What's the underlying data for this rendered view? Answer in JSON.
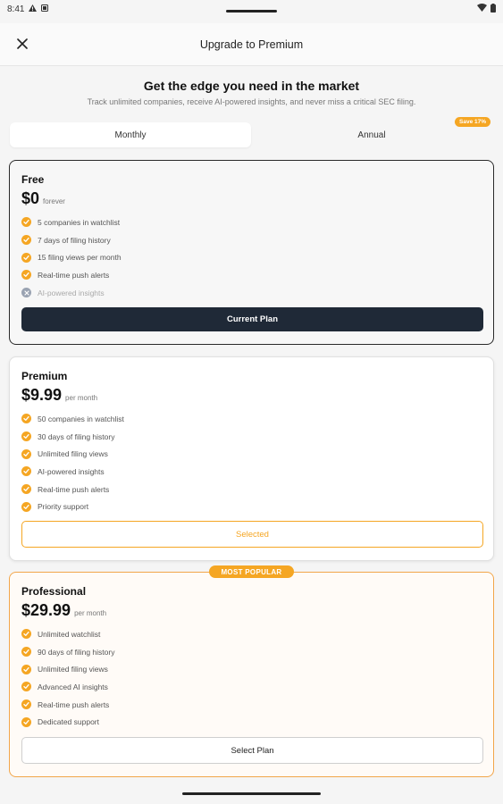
{
  "status": {
    "time": "8:41"
  },
  "appbar": {
    "title": "Upgrade to Premium"
  },
  "header": {
    "headline": "Get the edge you need in the market",
    "subline": "Track unlimited companies, receive AI-powered insights, and never miss a critical SEC filing."
  },
  "billing": {
    "monthly": "Monthly",
    "annual": "Annual",
    "save_badge": "Save 17%",
    "selected": "Monthly"
  },
  "plans": [
    {
      "name": "Free",
      "price": "$0",
      "period": "forever",
      "features": [
        {
          "text": "5 companies in watchlist",
          "included": true
        },
        {
          "text": "7 days of filing history",
          "included": true
        },
        {
          "text": "15 filing views per month",
          "included": true
        },
        {
          "text": "Real-time push alerts",
          "included": true
        },
        {
          "text": "AI-powered insights",
          "included": false
        }
      ],
      "button": "Current Plan"
    },
    {
      "name": "Premium",
      "price": "$9.99",
      "period": "per month",
      "features": [
        {
          "text": "50 companies in watchlist",
          "included": true
        },
        {
          "text": "30 days of filing history",
          "included": true
        },
        {
          "text": "Unlimited filing views",
          "included": true
        },
        {
          "text": "AI-powered insights",
          "included": true
        },
        {
          "text": "Real-time push alerts",
          "included": true
        },
        {
          "text": "Priority support",
          "included": true
        }
      ],
      "button": "Selected"
    },
    {
      "name": "Professional",
      "price": "$29.99",
      "period": "per month",
      "badge": "MOST POPULAR",
      "features": [
        {
          "text": "Unlimited watchlist",
          "included": true
        },
        {
          "text": "90 days of filing history",
          "included": true
        },
        {
          "text": "Unlimited filing views",
          "included": true
        },
        {
          "text": "Advanced AI insights",
          "included": true
        },
        {
          "text": "Real-time push alerts",
          "included": true
        },
        {
          "text": "Dedicated support",
          "included": true
        }
      ],
      "button": "Select Plan"
    }
  ],
  "colors": {
    "accent": "#f5a623",
    "dark": "#1f2937",
    "muted": "#9aa3b2"
  }
}
